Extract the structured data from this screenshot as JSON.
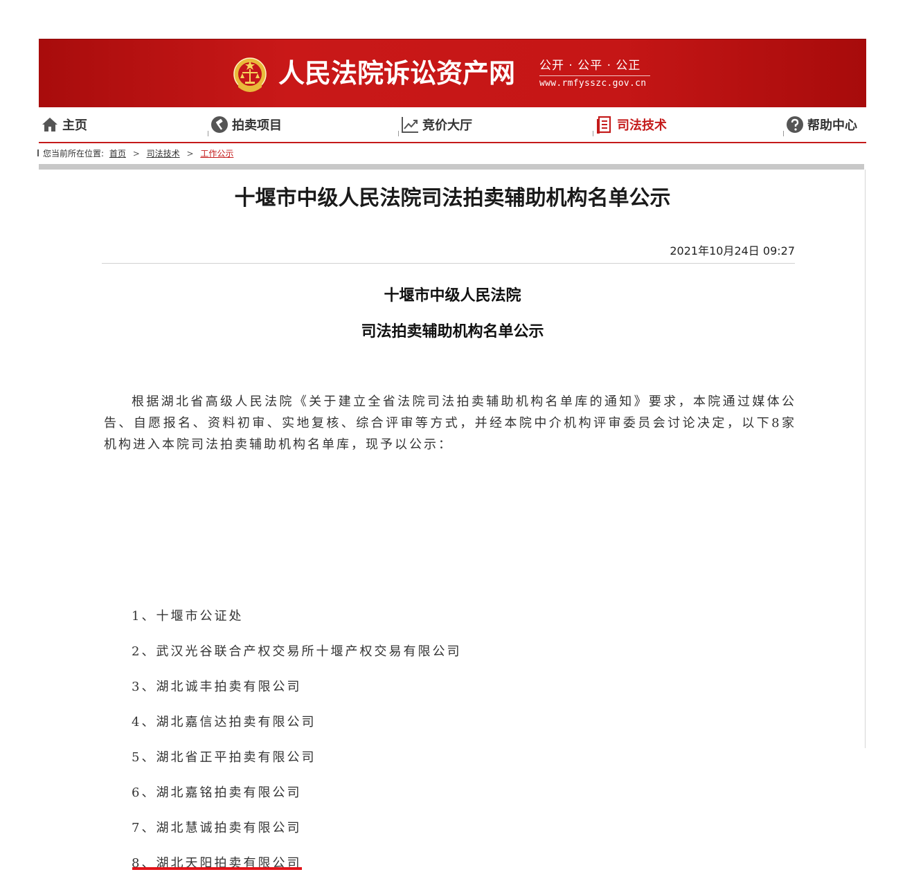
{
  "header": {
    "site_name": "人民法院诉讼资产网",
    "slogan": "公开 · 公平 · 公正",
    "url": "www.rmfysszc.gov.cn",
    "emblem_icon": "court-emblem-icon"
  },
  "nav": {
    "items": [
      {
        "label": "主页",
        "icon": "home-icon"
      },
      {
        "label": "拍卖项目",
        "icon": "auction-icon"
      },
      {
        "label": "竞价大厅",
        "icon": "chart-trend-icon"
      },
      {
        "label": "司法技术",
        "icon": "document-icon"
      },
      {
        "label": "帮助中心",
        "icon": "help-icon"
      }
    ],
    "active": "司法技术"
  },
  "breadcrumb": {
    "prefix": "您当前所在位置:",
    "items": [
      "首页",
      "司法技术",
      "工作公示"
    ],
    "separator": ">"
  },
  "article": {
    "title": "十堰市中级人民法院司法拍卖辅助机构名单公示",
    "datetime": "2021年10月24日 09:27",
    "heading_line1": "十堰市中级人民法院",
    "heading_line2": "司法拍卖辅助机构名单公示",
    "paragraph": "根据湖北省高级人民法院《关于建立全省法院司法拍卖辅助机构名单库的通知》要求，本院通过媒体公告、自愿报名、资料初审、实地复核、综合评审等方式，并经本院中介机构评审委员会讨论决定，以下8家机构进入本院司法拍卖辅助机构名单库，现予以公示：",
    "list": [
      "1、十堰市公证处",
      "2、武汉光谷联合产权交易所十堰产权交易有限公司",
      "3、湖北诚丰拍卖有限公司",
      "4、湖北嘉信达拍卖有限公司",
      "5、湖北省正平拍卖有限公司",
      "6、湖北嘉铭拍卖有限公司",
      "7、湖北慧诚拍卖有限公司",
      "8、湖北天阳拍卖有限公司"
    ]
  },
  "colors": {
    "brand_red": "#c41a1a",
    "annotation_red": "#e2141a"
  }
}
